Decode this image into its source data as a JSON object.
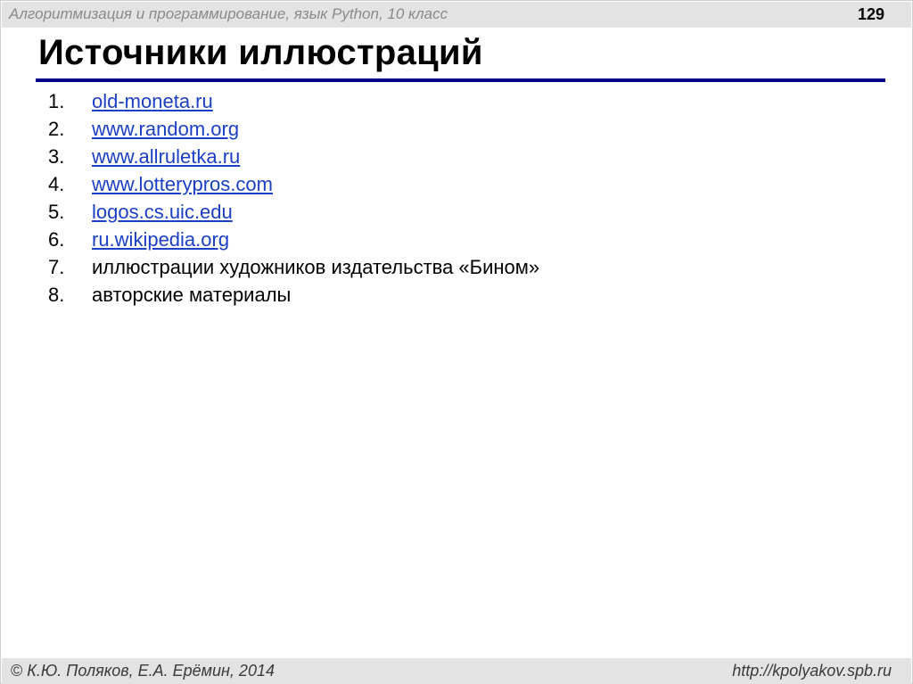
{
  "header": {
    "course": "Алгоритмизация и программирование, язык Python, 10 класс",
    "page_number": "129"
  },
  "title": "Источники иллюстраций",
  "colors": {
    "title_rule": "#00008a",
    "link": "#1a3fc4",
    "bar_background": "#e3e3e3"
  },
  "sources": [
    {
      "num": "1.",
      "text": "old-moneta.ru",
      "is_link": true
    },
    {
      "num": "2.",
      "text": "www.random.org",
      "is_link": true
    },
    {
      "num": "3.",
      "text": "www.allruletka.ru",
      "is_link": true
    },
    {
      "num": "4.",
      "text": "www.lotterypros.com",
      "is_link": true
    },
    {
      "num": "5.",
      "text": "logos.cs.uic.edu",
      "is_link": true
    },
    {
      "num": "6.",
      "text": "ru.wikipedia.org",
      "is_link": true
    },
    {
      "num": "7.",
      "text": "иллюстрации художников издательства «Бином»",
      "is_link": false
    },
    {
      "num": "8.",
      "text": "авторские материалы",
      "is_link": false
    }
  ],
  "footer": {
    "copyright_symbol": "©",
    "authors": "К.Ю. Поляков, Е.А. Ерёмин, 2014",
    "site": "http://kpolyakov.spb.ru"
  }
}
